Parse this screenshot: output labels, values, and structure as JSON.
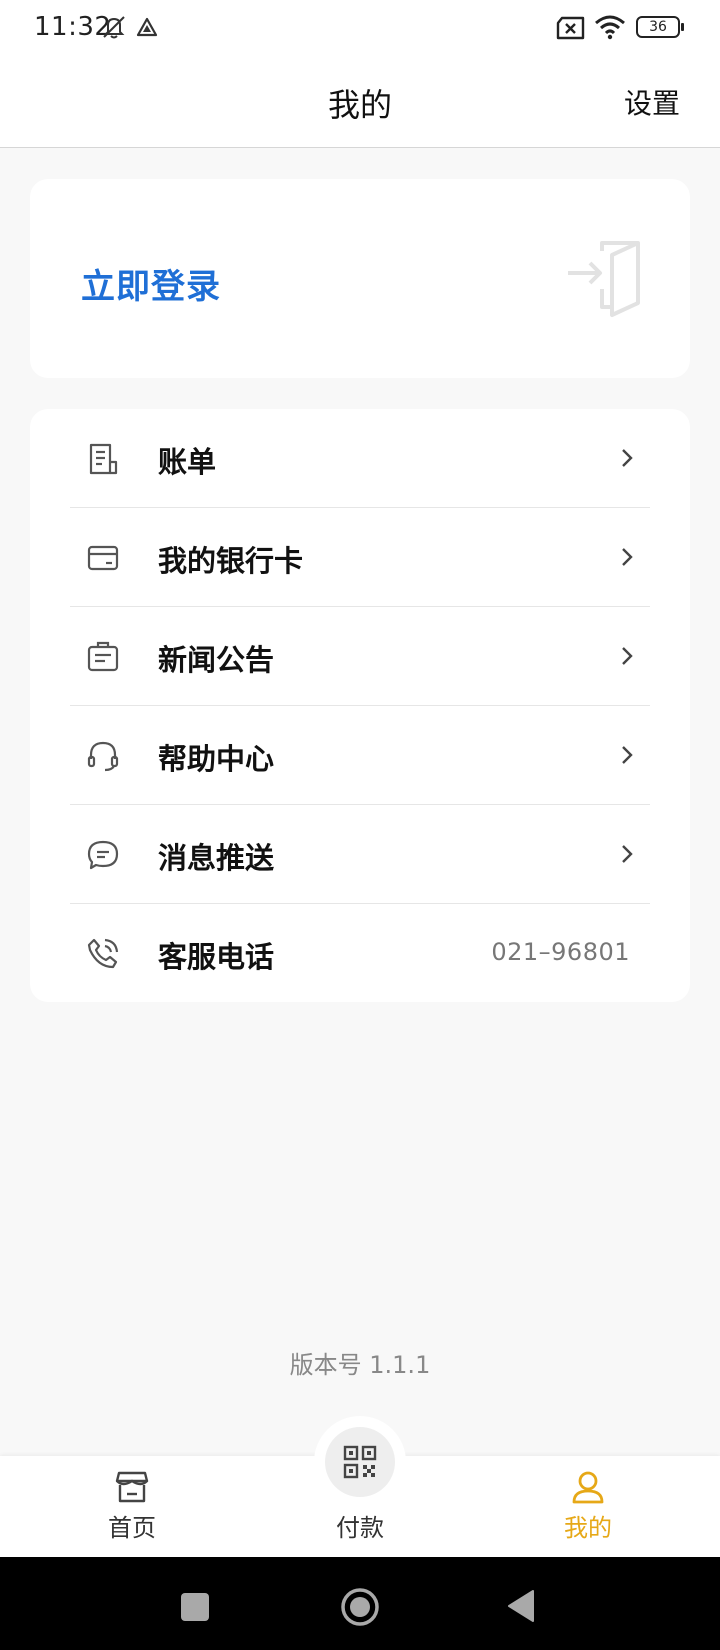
{
  "status_bar": {
    "time": "11:32",
    "battery": "36",
    "icons": [
      "mute-icon",
      "location-icon",
      "no-sim-icon",
      "wifi-icon",
      "battery-icon"
    ]
  },
  "header": {
    "title": "我的",
    "settings_label": "设置"
  },
  "login": {
    "label": "立即登录",
    "icon": "login-door-icon",
    "color": "#1f6fd6"
  },
  "menu": {
    "items": [
      {
        "label": "账单",
        "icon": "bill-icon"
      },
      {
        "label": "我的银行卡",
        "icon": "bank-card-icon"
      },
      {
        "label": "新闻公告",
        "icon": "news-icon"
      },
      {
        "label": "帮助中心",
        "icon": "headset-icon"
      },
      {
        "label": "消息推送",
        "icon": "message-icon"
      },
      {
        "label": "客服电话",
        "icon": "phone-icon",
        "value": "021–96801"
      }
    ]
  },
  "version": "版本号 1.1.1",
  "tabs": [
    {
      "label": "首页",
      "icon": "store-icon"
    },
    {
      "label": "付款",
      "icon": "qr-code-icon"
    },
    {
      "label": "我的",
      "icon": "user-icon",
      "active": true
    }
  ],
  "colors": {
    "accent": "#e6a817",
    "link": "#1f6fd6",
    "background": "#f8f8f8"
  }
}
